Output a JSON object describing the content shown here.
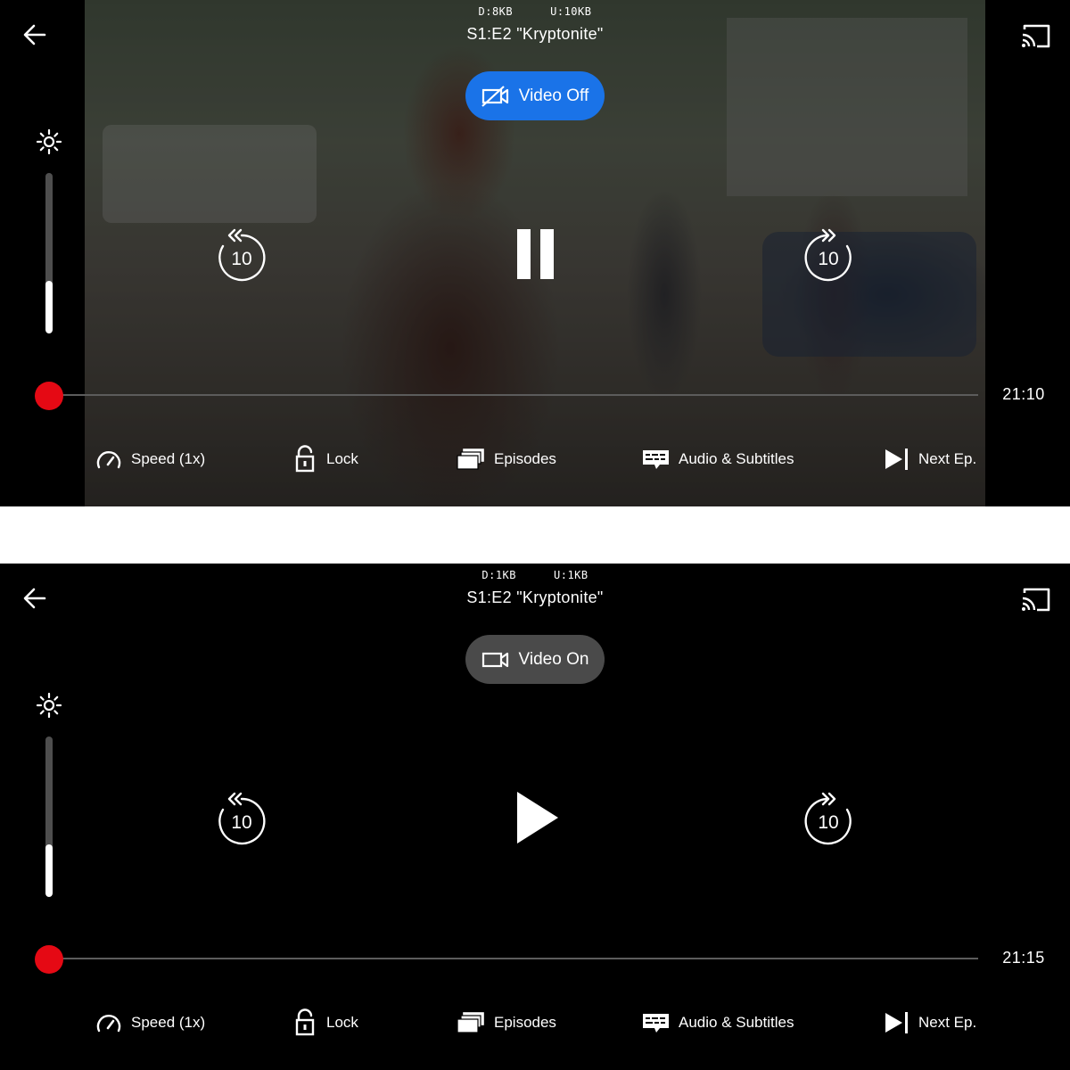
{
  "screens": [
    {
      "stats": {
        "download": "D:8KB",
        "upload": "U:10KB"
      },
      "title": "S1:E2 \"Kryptonite\"",
      "video_toggle": {
        "label": "Video Off",
        "state": "off",
        "color": "#1a73e8"
      },
      "brightness_level": 0.33,
      "skip_back": "10",
      "skip_forward": "10",
      "playback_state": "playing",
      "center_icon": "pause-icon",
      "progress": 0.0,
      "time_remaining": "21:10"
    },
    {
      "stats": {
        "download": "D:1KB",
        "upload": "U:1KB"
      },
      "title": "S1:E2 \"Kryptonite\"",
      "video_toggle": {
        "label": "Video On",
        "state": "on",
        "color": "#4a4a4a"
      },
      "brightness_level": 0.33,
      "skip_back": "10",
      "skip_forward": "10",
      "playback_state": "paused",
      "center_icon": "play-icon",
      "progress": 0.0,
      "time_remaining": "21:15"
    }
  ],
  "bottom_bar": {
    "speed": "Speed (1x)",
    "lock": "Lock",
    "episodes": "Episodes",
    "audio_subtitles": "Audio & Subtitles",
    "next_episode": "Next Ep."
  },
  "colors": {
    "accent": "#e50914",
    "toggle_blue": "#1a73e8",
    "toggle_gray": "#4a4a4a"
  },
  "icons": [
    "back-arrow-icon",
    "cast-icon",
    "brightness-icon",
    "replay-10-icon",
    "forward-10-icon",
    "pause-icon",
    "play-icon",
    "speedometer-icon",
    "unlock-icon",
    "episodes-icon",
    "subtitles-icon",
    "next-episode-icon",
    "video-off-icon",
    "video-on-icon"
  ]
}
